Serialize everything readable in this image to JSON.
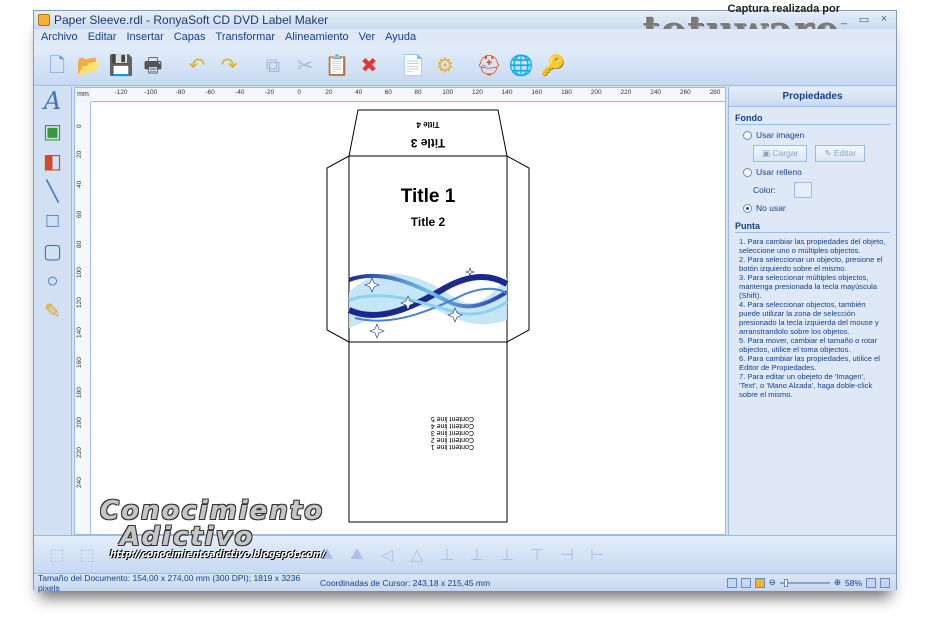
{
  "window": {
    "title": "Paper Sleeve.rdl - RonyaSoft CD DVD Label Maker",
    "controls": [
      "_",
      "▭",
      "×"
    ]
  },
  "watermark_top": {
    "small": "Captura realizada por",
    "big": "totuware"
  },
  "menu": [
    "Archivo",
    "Editar",
    "Insertar",
    "Capas",
    "Transformar",
    "Alineamiento",
    "Ver",
    "Ayuda"
  ],
  "toolbar": {
    "icons": [
      "new-icon",
      "open-icon",
      "save-icon",
      "print-icon",
      "undo-icon",
      "redo-icon",
      "copy-icon",
      "cut-icon",
      "paste-icon",
      "delete-icon",
      "properties-icon",
      "settings-icon",
      "help-icon",
      "web-icon",
      "key-icon"
    ],
    "glyphs": [
      "🗋",
      "📂",
      "💾",
      "🖶",
      "↶",
      "↷",
      "⧉",
      "✂",
      "📋",
      "✖",
      "📄",
      "⚙",
      "⛑",
      "🌐",
      "🔑"
    ],
    "colors": [
      "#5a8fd6",
      "#f0b030",
      "#3b6fc5",
      "#555555",
      "#e0b020",
      "#e0b020",
      "#9fb9dc",
      "#9fb9dc",
      "#9fb9dc",
      "#e03a2f",
      "#f0b030",
      "#f0b030",
      "#e05020",
      "#2a8a3a",
      "#d9b860"
    ]
  },
  "left_tools": {
    "icons": [
      "text-tool-icon",
      "image-tool-icon",
      "layers-tool-icon",
      "line-tool-icon",
      "rectangle-tool-icon",
      "rounded-rect-tool-icon",
      "ellipse-tool-icon",
      "pen-tool-icon"
    ],
    "glyphs": [
      "A",
      "▣",
      "◧",
      "╲",
      "□",
      "▢",
      "○",
      "✎"
    ]
  },
  "ruler": {
    "unit": "mm",
    "h_ticks": [
      "-120",
      "-100",
      "-80",
      "-60",
      "-40",
      "-20",
      "0",
      "20",
      "40",
      "60",
      "80",
      "100",
      "120",
      "140",
      "160",
      "180",
      "200",
      "220",
      "240",
      "260",
      "280"
    ],
    "v_ticks": [
      "0",
      "20",
      "40",
      "60",
      "80",
      "100",
      "120",
      "140",
      "160",
      "180",
      "200",
      "220",
      "240"
    ]
  },
  "document": {
    "title1": "Title 1",
    "title2": "Title 2",
    "title3": "Title 3",
    "title4": "Title 4",
    "content_lines": [
      "Content line 1",
      "Content line 2",
      "Content line 3",
      "Content line 4",
      "Content line 5"
    ]
  },
  "properties": {
    "header": "Propiedades",
    "fondo_label": "Fondo",
    "usar_imagen": "Usar imagen",
    "cargar": "Cargar",
    "editar": "Editar",
    "usar_relleno": "Usar relleno",
    "color_label": "Color:",
    "no_usar": "No usar",
    "punta_label": "Punta",
    "selected_option": "No usar",
    "tips": [
      "1. Para cambiar las propiedades del objeto, seleccione uno o múltiples objectos.",
      "2. Para seleccionar un objecto, presione el botón izquierdo sobre el mismo.",
      "3. Para seleccionar múltiples objectos, mantenga presionada la tecla mayúscula (Shift).",
      "4. Para seleccionar objectos, también puede utilizar la zona de selección presionado la tecla izquierda del mouse y arranstrandolo sobre los objetos.",
      "5. Para mover, cambiar el tamaño o rotar objectos, utilice el toma objectos.",
      "6. Para cambiar las propiedades, utilice el Editor de Propiedades.",
      "7. Para editar un obejeto de 'Imagen', 'Text', o 'Mano Alzada', haga doble-click sobre el mismo."
    ]
  },
  "bottom_toolbar": {
    "icons": [
      "align-grid-icon",
      "distribute-icon",
      "align-a-icon",
      "align-b-icon",
      "align-c-icon",
      "align-d-icon",
      "align-e-icon",
      "align-f-icon",
      "align-g-icon",
      "flip-up-icon",
      "flip-up2-icon",
      "mirror-left-icon",
      "mirror-center-icon",
      "align-bottom-left-icon",
      "align-bottom-center-icon",
      "align-bottom-right-icon",
      "align-top-icon",
      "align-middle-icon",
      "align-right-icon"
    ],
    "glyphs": [
      "⬚",
      "⬚",
      "▭",
      "▭",
      "▭",
      "▭",
      "▭",
      "▭",
      "▭",
      "⛰",
      "⛰",
      "◁",
      "△",
      "⊥",
      "⊥",
      "⊥",
      "⊤",
      "⊣",
      "⊢"
    ]
  },
  "watermark_bottom": {
    "line1": "Conocimiento",
    "line2": "Adictivo",
    "url": "http://conocimientoadictivo.blogspot.com/"
  },
  "status": {
    "document_size": "Tamaño del Documento: 154,00 x 274,00 mm (300 DPI); 1819 x 3236 pixels",
    "cursor": "Coordinadas de Cursor: 243,18 x 215,45 mm",
    "zoom": "58%",
    "zoom_level": 0.1
  }
}
